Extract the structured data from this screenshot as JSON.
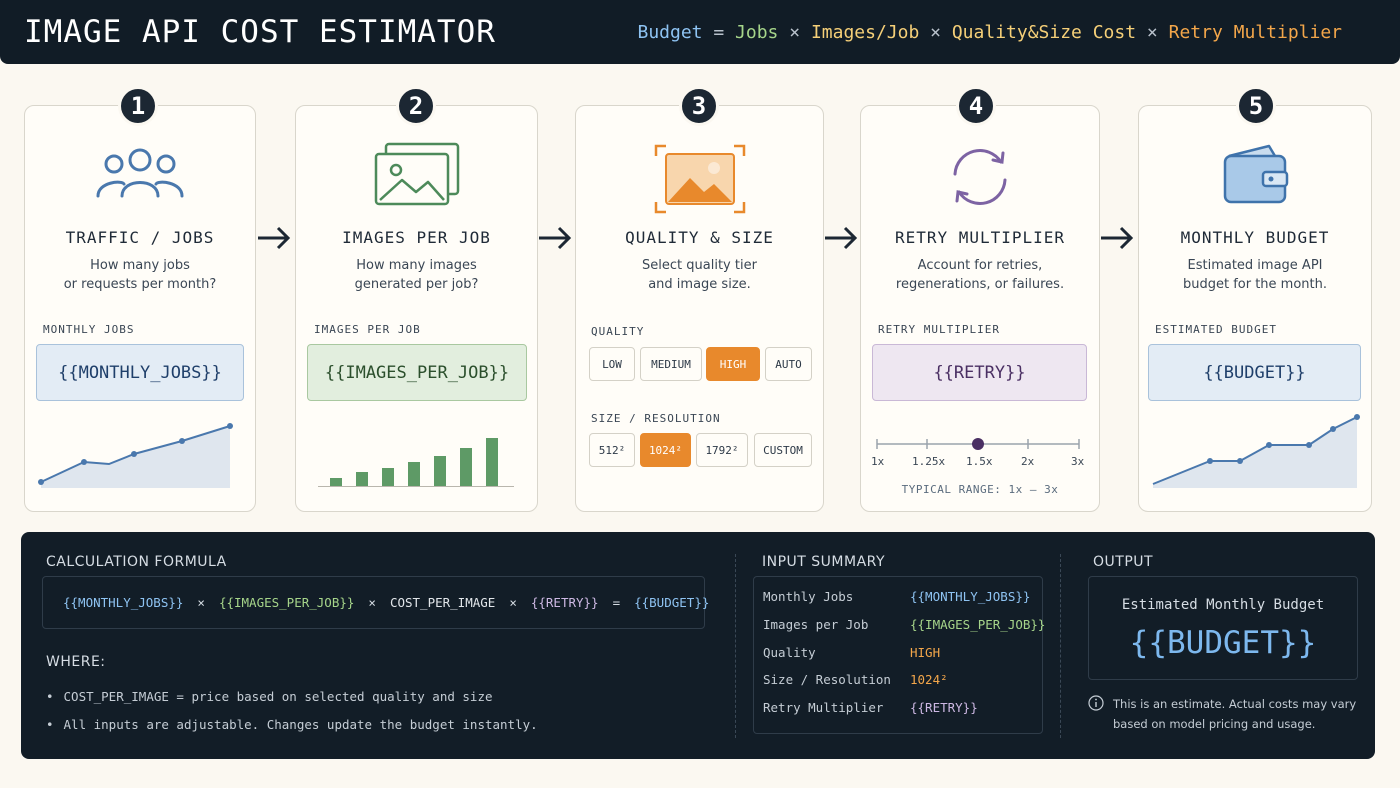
{
  "header": {
    "title": "IMAGE API COST ESTIMATOR",
    "formula": {
      "budget": "Budget",
      "eq": "=",
      "jobs": "Jobs",
      "x1": "×",
      "images": "Images/Job",
      "x2": "×",
      "quality": "Quality&Size Cost",
      "x3": "×",
      "retry": "Retry Multiplier"
    }
  },
  "steps": [
    {
      "number": "1",
      "title": "TRAFFIC / JOBS",
      "description": "How many jobs\nor requests per month?",
      "field_label": "MONTHLY JOBS",
      "field_value": "{{MONTHLY_JOBS}}",
      "icon": "users-icon"
    },
    {
      "number": "2",
      "title": "IMAGES PER JOB",
      "description": "How many images\ngenerated per job?",
      "field_label": "IMAGES PER JOB",
      "field_value": "{{IMAGES_PER_JOB}}",
      "icon": "images-icon"
    },
    {
      "number": "3",
      "title": "QUALITY & SIZE",
      "description": "Select quality tier\nand image size.",
      "quality_label": "QUALITY",
      "quality_options": [
        "LOW",
        "MEDIUM",
        "HIGH",
        "AUTO"
      ],
      "quality_selected": "HIGH",
      "size_label": "SIZE / RESOLUTION",
      "size_options": [
        "512²",
        "1024²",
        "1792²",
        "CUSTOM"
      ],
      "size_selected": "1024²",
      "icon": "image-frame-icon"
    },
    {
      "number": "4",
      "title": "RETRY MULTIPLIER",
      "description": "Account for retries,\nregenerations, or failures.",
      "field_label": "RETRY MULTIPLIER",
      "field_value": "{{RETRY}}",
      "slider_ticks": [
        "1x",
        "1.25x",
        "1.5x",
        "2x",
        "3x"
      ],
      "slider_value": "1.5x",
      "range_note": "TYPICAL RANGE: 1x – 3x",
      "icon": "refresh-icon"
    },
    {
      "number": "5",
      "title": "MONTHLY BUDGET",
      "description": "Estimated image API\nbudget for the month.",
      "field_label": "ESTIMATED BUDGET",
      "field_value": "{{BUDGET}}",
      "icon": "wallet-icon"
    }
  ],
  "calculation": {
    "label": "CALCULATION FORMULA",
    "terms": [
      "{{MONTHLY_JOBS}}",
      "×",
      "{{IMAGES_PER_JOB}}",
      "×",
      "COST_PER_IMAGE",
      "×",
      "{{RETRY}}",
      "=",
      "{{BUDGET}}"
    ],
    "where_label": "WHERE:",
    "bullets": [
      "COST_PER_IMAGE = price based on selected quality and size",
      "All inputs are adjustable. Changes update the budget instantly."
    ]
  },
  "input_summary": {
    "label": "INPUT SUMMARY",
    "rows": [
      {
        "key": "Monthly Jobs",
        "value": "{{MONTHLY_JOBS}}"
      },
      {
        "key": "Images per Job",
        "value": "{{IMAGES_PER_JOB}}"
      },
      {
        "key": "Quality",
        "value": "HIGH"
      },
      {
        "key": "Size / Resolution",
        "value": "1024²"
      },
      {
        "key": "Retry Multiplier",
        "value": "{{RETRY}}"
      }
    ]
  },
  "output": {
    "label": "OUTPUT",
    "box_label": "Estimated Monthly Budget",
    "box_value": "{{BUDGET}}",
    "note": "This is an estimate. Actual costs may vary based on model pricing and usage."
  },
  "colors": {
    "blue": "#8ec3f2",
    "green": "#a6d58a",
    "yellow": "#f5cf78",
    "orange": "#e8892c",
    "purple": "#6b4d8a",
    "dark": "#111c26"
  }
}
